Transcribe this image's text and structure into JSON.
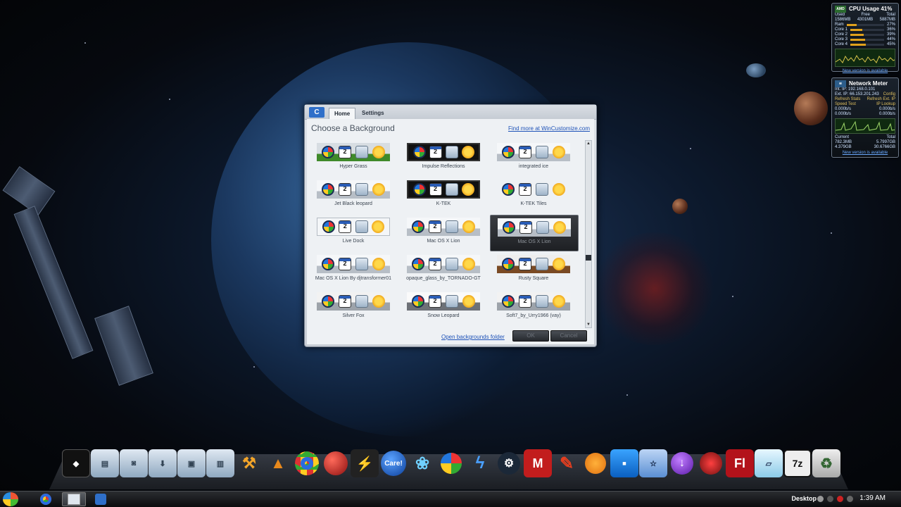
{
  "dialog": {
    "app_icon": "C",
    "tabs": [
      "Home",
      "Settings"
    ],
    "heading": "Choose a Background",
    "more_link": "Find more at WinCustomize.com",
    "open_folder_link": "Open backgrounds folder",
    "ok_label": "OK",
    "cancel_label": "Cancel",
    "calendar_day": "2",
    "scroll_up": "▲",
    "scroll_down": "▼",
    "backgrounds": [
      {
        "label": "Hyper Grass",
        "style": "grass"
      },
      {
        "label": "Impulse Reflections",
        "style": "dark"
      },
      {
        "label": "integrated ice",
        "style": "glass"
      },
      {
        "label": "Jet Black leopard",
        "style": "glass"
      },
      {
        "label": "K-TEK",
        "style": "dark"
      },
      {
        "label": "K-TEK Tiles",
        "style": "tile"
      },
      {
        "label": "Live Dock",
        "style": "lightbar"
      },
      {
        "label": "Mac OS X Lion",
        "style": "glass"
      },
      {
        "label": "Mac OS X Lion",
        "style": "glass",
        "selected": true
      },
      {
        "label": "Mac OS X Lion By djtransformer01",
        "style": "glass"
      },
      {
        "label": "opaque_glass_by_TORNADO-GT",
        "style": "glass"
      },
      {
        "label": "Rusty Square",
        "style": "rust"
      },
      {
        "label": "Silver Fox",
        "style": "gray"
      },
      {
        "label": "Snow Leopard",
        "style": "darkbar"
      },
      {
        "label": "Soft7_by_Urry1966 (vay)",
        "style": "gray"
      }
    ]
  },
  "cpu_gadget": {
    "brand": "AMD",
    "title": "CPU Usage 41%",
    "headers": [
      "Used",
      "Free",
      "Total"
    ],
    "values": [
      "1586MB",
      "4301MB",
      "5887MB"
    ],
    "rows": [
      {
        "name": "Ram",
        "value": "27%",
        "level": 0.27
      },
      {
        "name": "Core 1",
        "value": "36%",
        "level": 0.36
      },
      {
        "name": "Core 2",
        "value": "39%",
        "level": 0.39
      },
      {
        "name": "Core 3",
        "value": "44%",
        "level": 0.44
      },
      {
        "name": "Core 4",
        "value": "45%",
        "level": 0.45
      }
    ],
    "link": "New version is available"
  },
  "net_gadget": {
    "title": "Network Meter",
    "int_ip": "Int. IP: 192.168.0.101",
    "ext_ip": "Ext. IP: 66.153.201.243",
    "ext_ip_action": "Config",
    "actions": [
      "Refresh Stats",
      "Refresh Ext. IP",
      "Speed Test",
      "IP Lookup"
    ],
    "rates": [
      "0.000b/s",
      "0.000b/s",
      "0.000b/s",
      "0.000b/s"
    ],
    "headers": [
      "Current",
      "Total"
    ],
    "totals": [
      "782.3MB",
      "5.7997GB",
      "4.379GB",
      "30.6766GB"
    ],
    "link": "New version is available"
  },
  "taskbar": {
    "desktop_label": "Desktop",
    "clock": "1:39 AM"
  },
  "dock_labels": [
    "Care!",
    "Fl",
    "7z"
  ]
}
